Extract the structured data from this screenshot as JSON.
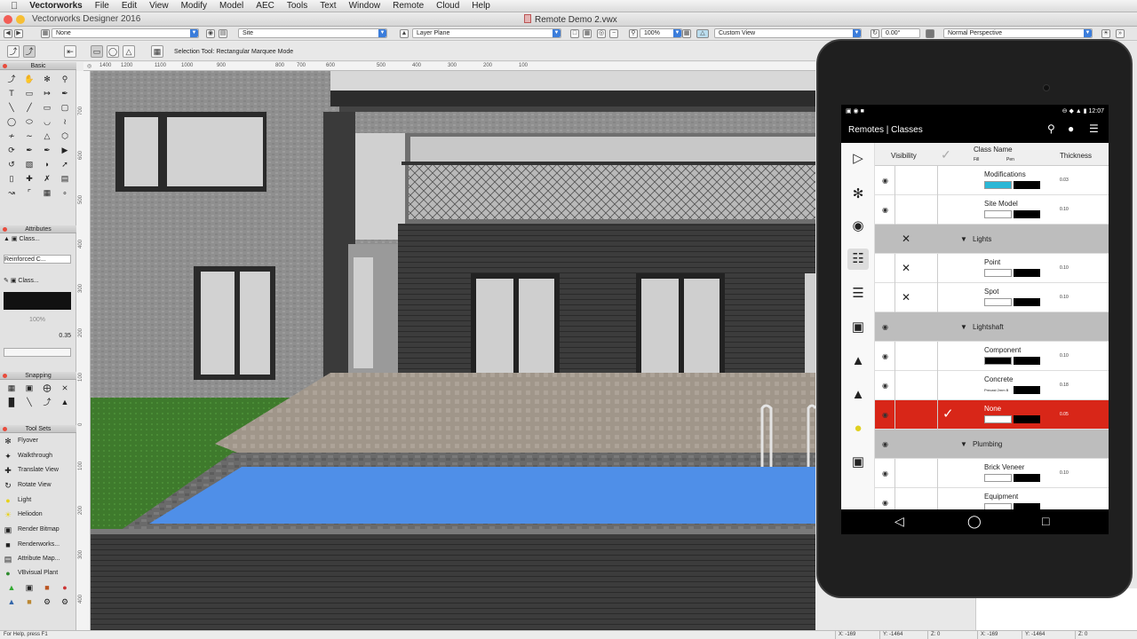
{
  "menubar": {
    "app_name": "Vectorworks",
    "items": [
      "File",
      "Edit",
      "View",
      "Modify",
      "Model",
      "AEC",
      "Tools",
      "Text",
      "Window",
      "Remote",
      "Cloud",
      "Help"
    ]
  },
  "titlebar": {
    "app_title": "Vectorworks Designer 2016",
    "document_title": "Remote Demo 2.vwx"
  },
  "viewbar": {
    "class_select": "None",
    "layer_select": "Site",
    "plane_select": "Layer Plane",
    "zoom": "100%",
    "view_select": "Custom View",
    "rotation": "0.00°",
    "render_select": "Normal Perspective"
  },
  "modebar": {
    "status_text": "Selection Tool: Rectangular Marquee Mode"
  },
  "palettes": {
    "basic_title": "Basic",
    "attributes_title": "Attributes",
    "attr_fill": "Class...",
    "attr_hatch": "Reinforced C...",
    "attr_pen": "Class...",
    "attr_opacity": "100%",
    "attr_lineweight": "0.35",
    "snapping_title": "Snapping",
    "toolsets_title": "Tool Sets",
    "toolsets": [
      "Flyover",
      "Walkthrough",
      "Translate View",
      "Rotate View",
      "Light",
      "Heliodon",
      "Render Bitmap",
      "Renderworks...",
      "Attribute Map...",
      "VBvisual Plant"
    ]
  },
  "ruler": {
    "h_ticks": [
      "1400",
      "1200",
      "1100",
      "1000",
      "900",
      "800",
      "700",
      "600",
      "500",
      "400",
      "300",
      "200",
      "100"
    ],
    "v_ticks": [
      "700",
      "600",
      "500",
      "400",
      "300",
      "200",
      "100",
      "0",
      "100",
      "200",
      "300",
      "400"
    ]
  },
  "statusbar": {
    "help": "For Help, press F1",
    "x": "X: -169",
    "y": "Y: -1464",
    "z": "Z: 0",
    "x2": "X: -169",
    "y2": "Y: -1464",
    "z2": "Z: 0"
  },
  "phone": {
    "time": "12:07",
    "app_title": "Remotes | Classes",
    "columns": {
      "visibility": "Visibility",
      "class_name": "Class Name",
      "fill": "Fill",
      "pen": "Pen",
      "thickness": "Thickness"
    },
    "rows": [
      {
        "type": "item",
        "name": "Modifications",
        "thickness": "0.03",
        "visible": true,
        "fill_color": "#2ab7d6"
      },
      {
        "type": "item",
        "name": "Site Model",
        "thickness": "0.10",
        "visible": true
      },
      {
        "type": "group",
        "name": "Lights",
        "hidden": true
      },
      {
        "type": "item",
        "name": "Point",
        "thickness": "0.10",
        "visible": false
      },
      {
        "type": "item",
        "name": "Spot",
        "thickness": "0.10",
        "visible": false
      },
      {
        "type": "group",
        "name": "Lightshaft",
        "visible": true
      },
      {
        "type": "item",
        "name": "Component",
        "thickness": "0.10",
        "visible": true,
        "fill_color": "#000000"
      },
      {
        "type": "item",
        "name": "Concrete",
        "thickness": "0.18",
        "visible": true,
        "fill_label": "Precast 2mm B"
      },
      {
        "type": "item",
        "name": "None",
        "thickness": "0.05",
        "visible": true,
        "active": true
      },
      {
        "type": "group",
        "name": "Plumbing",
        "visible": true
      },
      {
        "type": "item",
        "name": "Brick Veneer",
        "thickness": "0.10",
        "visible": true
      },
      {
        "type": "item",
        "name": "Equipment",
        "thickness": "",
        "visible": true
      }
    ]
  },
  "colors": {
    "accent": "#3b7ddb",
    "active_row": "#d82618",
    "pool": "#4f8fe8",
    "grass": "#3f7f2e"
  }
}
